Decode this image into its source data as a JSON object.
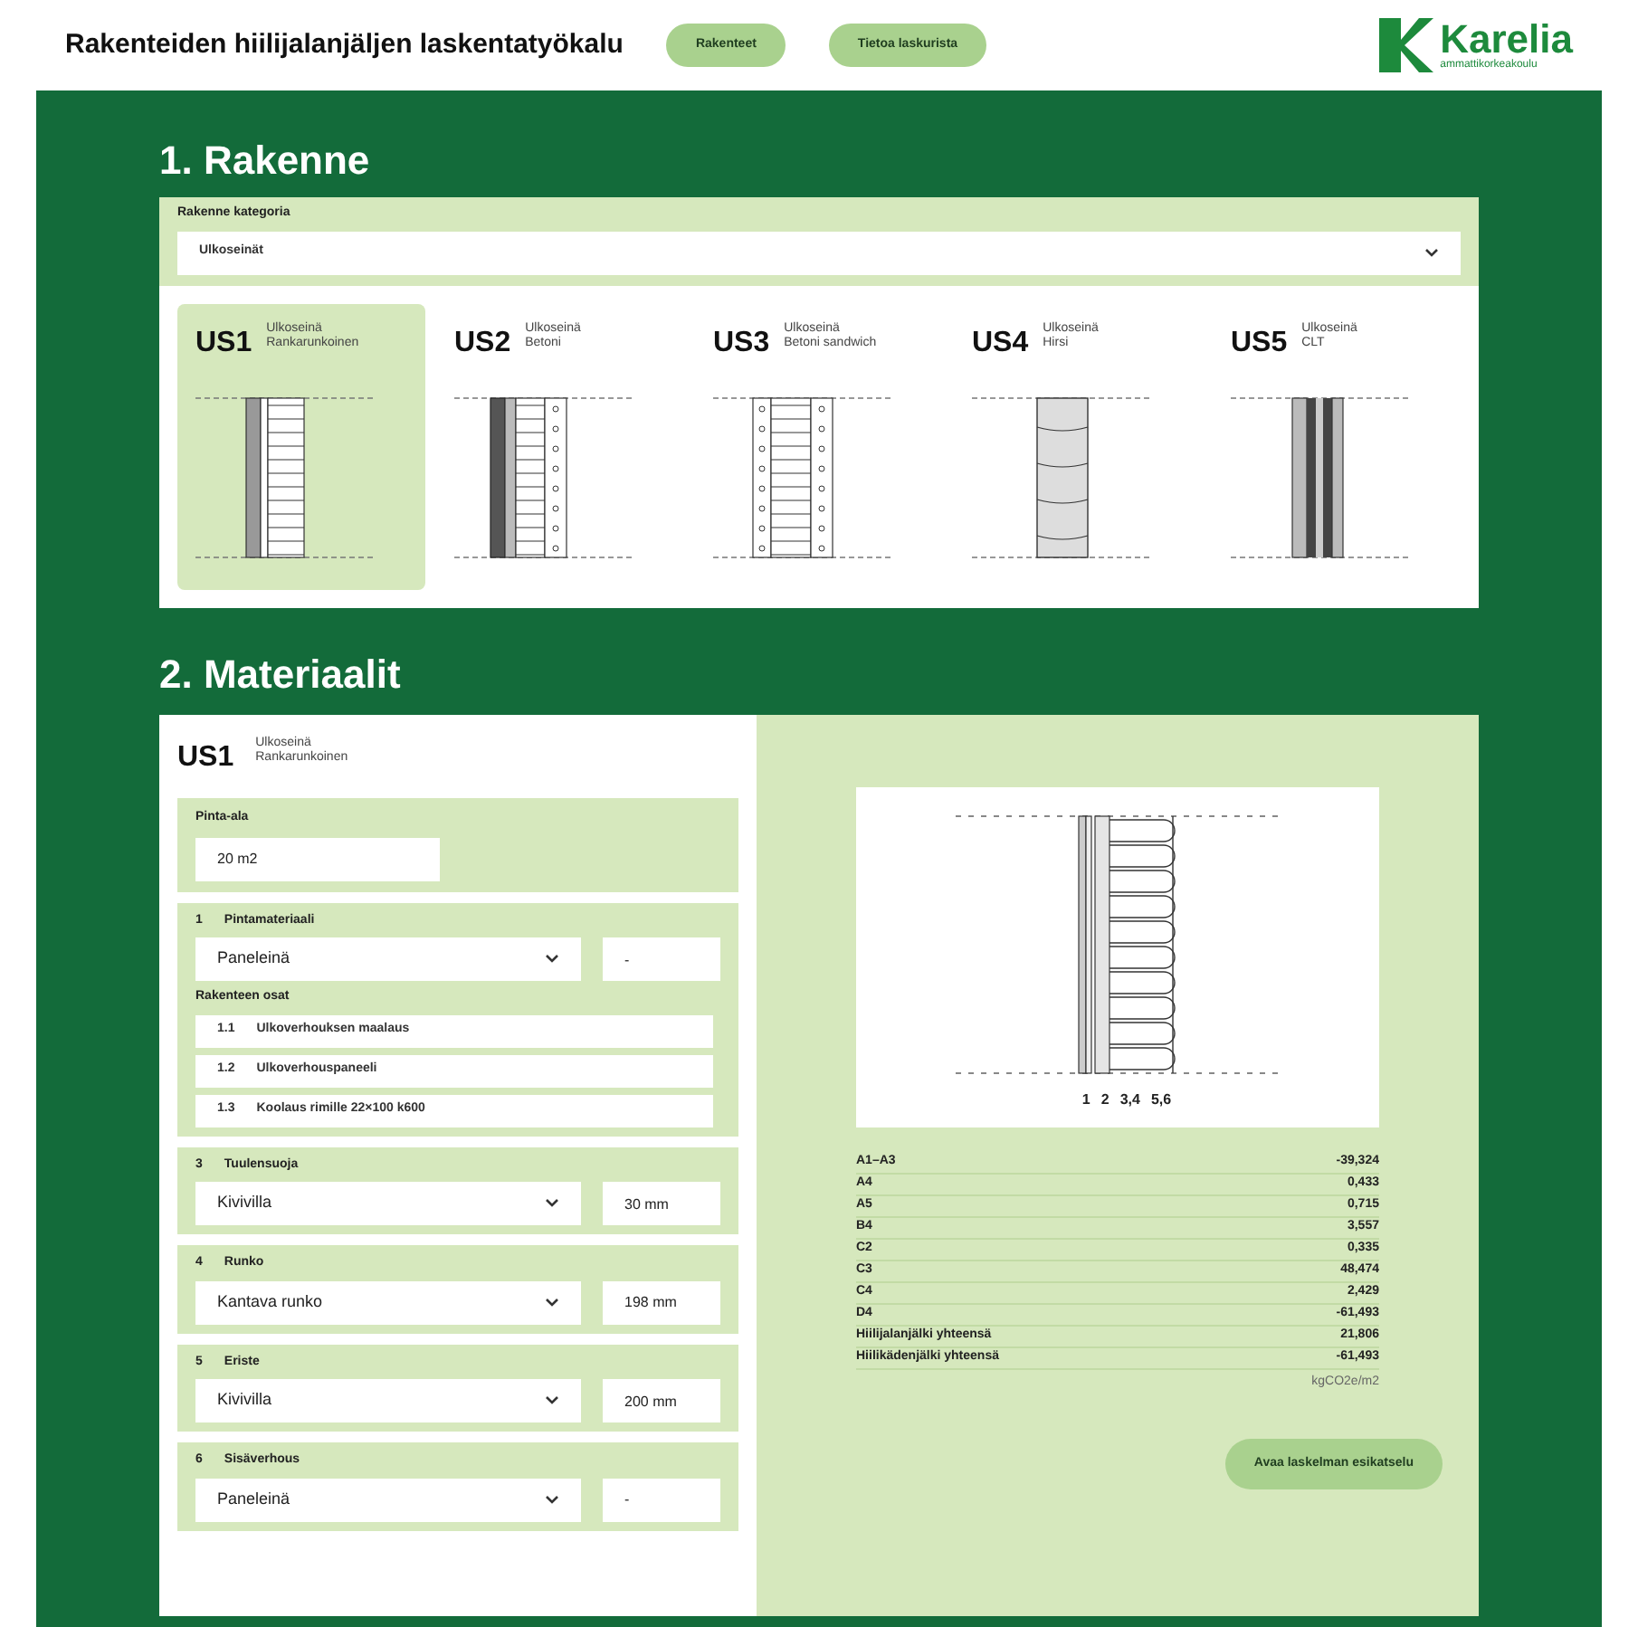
{
  "header": {
    "title": "Rakenteiden hiilijalanjäljen laskentatyökalu",
    "nav": [
      {
        "label": "Rakenteet"
      },
      {
        "label": "Tietoa laskurista"
      }
    ],
    "logo": {
      "name": "Karelia",
      "tagline": "ammattikorkeakoulu"
    }
  },
  "section1": {
    "heading": "1. Rakenne",
    "category": {
      "label": "Rakenne kategoria",
      "value": "Ulkoseinät"
    },
    "structures": [
      {
        "code": "US1",
        "type": "Ulkoseinä",
        "subtype": "Rankarunkoinen",
        "kind": "frame",
        "selected": true
      },
      {
        "code": "US2",
        "type": "Ulkoseinä",
        "subtype": "Betoni",
        "kind": "concrete",
        "selected": false
      },
      {
        "code": "US3",
        "type": "Ulkoseinä",
        "subtype": "Betoni sandwich",
        "kind": "sandwich",
        "selected": false
      },
      {
        "code": "US4",
        "type": "Ulkoseinä",
        "subtype": "Hirsi",
        "kind": "log",
        "selected": false
      },
      {
        "code": "US5",
        "type": "Ulkoseinä",
        "subtype": "CLT",
        "kind": "clt",
        "selected": false
      }
    ]
  },
  "section2": {
    "heading": "2. Materiaalit",
    "structure": {
      "code": "US1",
      "type": "Ulkoseinä",
      "subtype": "Rankarunkoinen"
    },
    "area": {
      "label": "Pinta-ala",
      "value": "20 m2"
    },
    "layers": [
      {
        "number": "1",
        "name": "Pintamateriaali",
        "material": "Paneleinä",
        "thickness": "-",
        "parts_label": "Rakenteen osat",
        "parts": [
          {
            "number": "1.1",
            "name": "Ulkoverhouksen maalaus"
          },
          {
            "number": "1.2",
            "name": "Ulkoverhouspaneeli"
          },
          {
            "number": "1.3",
            "name": "Koolaus rimille 22×100 k600"
          }
        ]
      },
      {
        "number": "3",
        "name": "Tuulensuoja",
        "material": "Kivivilla",
        "thickness": "30 mm"
      },
      {
        "number": "4",
        "name": "Runko",
        "material": "Kantava runko",
        "thickness": "198 mm"
      },
      {
        "number": "5",
        "name": "Eriste",
        "material": "Kivivilla",
        "thickness": "200 mm"
      },
      {
        "number": "6",
        "name": "Sisäverhous",
        "material": "Paneleinä",
        "thickness": "-"
      }
    ],
    "drawing_labels": [
      "1",
      "2",
      "3,4",
      "5,6"
    ],
    "results": [
      {
        "label": "A1–A3",
        "value": "-39,324"
      },
      {
        "label": "A4",
        "value": "0,433"
      },
      {
        "label": "A5",
        "value": "0,715"
      },
      {
        "label": "B4",
        "value": "3,557"
      },
      {
        "label": "C2",
        "value": "0,335"
      },
      {
        "label": "C3",
        "value": "48,474"
      },
      {
        "label": "C4",
        "value": "2,429"
      },
      {
        "label": "D4",
        "value": "-61,493"
      },
      {
        "label": "Hiilijalanjälki yhteensä",
        "value": "21,806"
      },
      {
        "label": "Hiilikädenjälki yhteensä",
        "value": "-61,493"
      }
    ],
    "unit": "kgCO2e/m2",
    "action": "Avaa laskelman esikatselu"
  }
}
